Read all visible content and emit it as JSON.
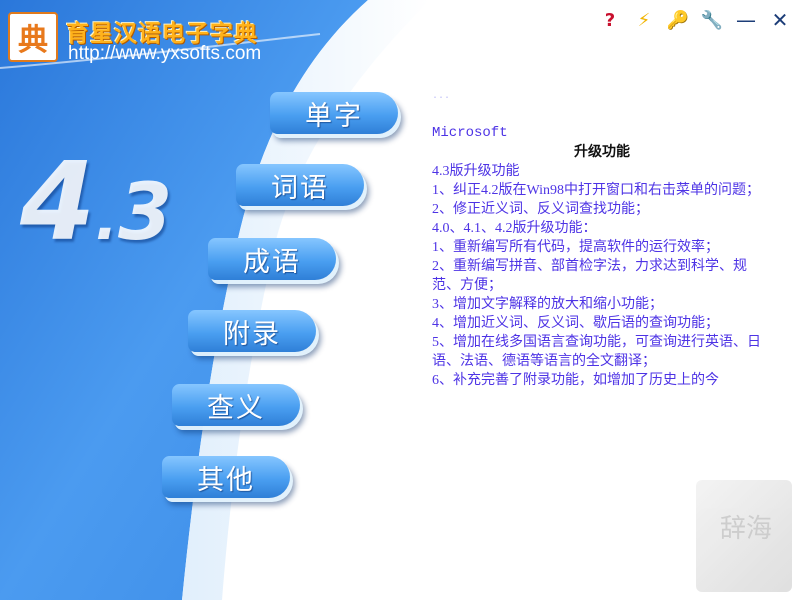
{
  "header": {
    "logo_glyph": "典",
    "app_title": "育星汉语电子字典",
    "app_url": "http://www.yxsofts.com"
  },
  "version": {
    "major": "4",
    "dot": ".",
    "minor": "3"
  },
  "toolbar": {
    "help_icon": "?",
    "update_icon": "⚡",
    "key_icon": "🔑",
    "settings_icon": "🔧",
    "minimize": "—",
    "close": "✕"
  },
  "menu": {
    "items": [
      {
        "label": "单字"
      },
      {
        "label": "词语"
      },
      {
        "label": "成语"
      },
      {
        "label": "附录"
      },
      {
        "label": "查义"
      },
      {
        "label": "其他"
      }
    ]
  },
  "content": {
    "top_faded": "...",
    "lines": [
      {
        "text": "Microsoft",
        "style": "mono"
      },
      {
        "text": "升级功能",
        "style": "heading"
      },
      {
        "text": "4.3版升级功能",
        "style": "normal"
      },
      {
        "text": "1、纠正4.2版在Win98中打开窗口和右击菜单的问题；",
        "style": "normal"
      },
      {
        "text": "2、修正近义词、反义词查找功能；",
        "style": "normal"
      },
      {
        "text": "4.0、4.1、4.2版升级功能：",
        "style": "normal"
      },
      {
        "text": "1、重新编写所有代码，提高软件的运行效率；",
        "style": "normal"
      },
      {
        "text": "2、重新编写拼音、部首检字法，力求达到科学、规范、方便；",
        "style": "normal"
      },
      {
        "text": "3、增加文字解释的放大和缩小功能；",
        "style": "normal"
      },
      {
        "text": "4、增加近义词、反义词、歇后语的查询功能；",
        "style": "normal"
      },
      {
        "text": "5、增加在线多国语言查询功能，可查询进行英语、日语、法语、德语等语言的全文翻译；",
        "style": "normal"
      },
      {
        "text": "6、补充完善了附录功能，如增加了历史上的今",
        "style": "normal"
      }
    ]
  },
  "corner_art": {
    "text": "辞海"
  },
  "colors": {
    "panel_blue": "#3d8de8",
    "accent_orange": "#ffb21a",
    "text_purple": "#4d33e5"
  }
}
